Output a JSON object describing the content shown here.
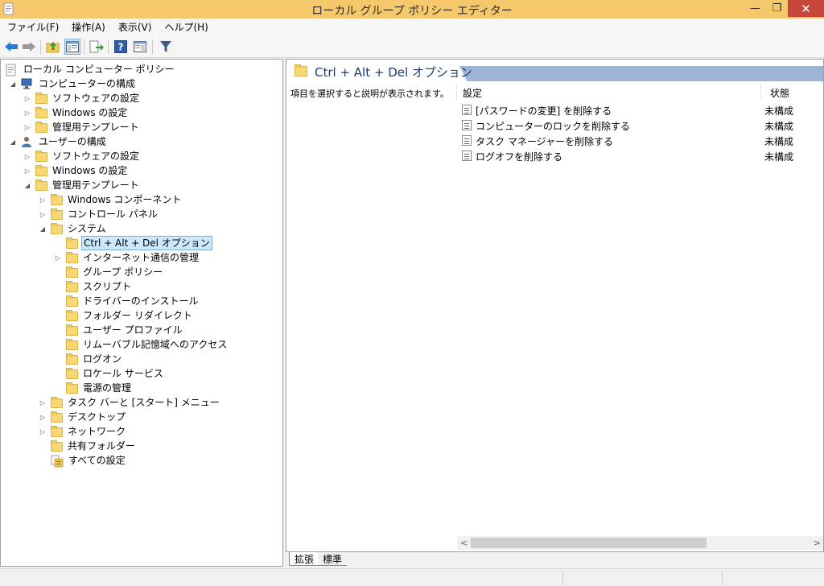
{
  "window": {
    "title": "ローカル グループ ポリシー エディター",
    "min_glyph": "—",
    "max_glyph": "❐",
    "close_glyph": "✕"
  },
  "menu": [
    {
      "label": "ファイル(F)"
    },
    {
      "label": "操作(A)"
    },
    {
      "label": "表示(V)"
    },
    {
      "label": "ヘルプ(H)"
    }
  ],
  "toolbar": {
    "icons": [
      "back-icon",
      "forward-icon",
      "up-folder-icon",
      "show-hide-tree-icon",
      "export-list-icon",
      "help-icon",
      "properties-icon",
      "filter-icon"
    ],
    "colors": {
      "arrow": "#2a7ad4",
      "filter": "#3c5a8a"
    }
  },
  "tree": {
    "items": [
      {
        "label": "ローカル コンピューター ポリシー",
        "level": 0,
        "expander": "",
        "icon": "policy-doc-icon"
      },
      {
        "label": "コンピューターの構成",
        "level": 1,
        "expander": "◢",
        "icon": "computer-icon"
      },
      {
        "label": "ソフトウェアの設定",
        "level": 2,
        "expander": "▷",
        "icon": "folder-icon"
      },
      {
        "label": "Windows の設定",
        "level": 2,
        "expander": "▷",
        "icon": "folder-icon"
      },
      {
        "label": "管理用テンプレート",
        "level": 2,
        "expander": "▷",
        "icon": "folder-icon"
      },
      {
        "label": "ユーザーの構成",
        "level": 1,
        "expander": "◢",
        "icon": "user-icon"
      },
      {
        "label": "ソフトウェアの設定",
        "level": 2,
        "expander": "▷",
        "icon": "folder-icon"
      },
      {
        "label": "Windows の設定",
        "level": 2,
        "expander": "▷",
        "icon": "folder-icon"
      },
      {
        "label": "管理用テンプレート",
        "level": 2,
        "expander": "◢",
        "icon": "folder-icon"
      },
      {
        "label": "Windows コンポーネント",
        "level": 3,
        "expander": "▷",
        "icon": "folder-icon"
      },
      {
        "label": "コントロール パネル",
        "level": 3,
        "expander": "▷",
        "icon": "folder-icon"
      },
      {
        "label": "システム",
        "level": 3,
        "expander": "◢",
        "icon": "folder-icon"
      },
      {
        "label": "Ctrl + Alt + Del オプション",
        "level": 4,
        "expander": "",
        "icon": "folder-icon",
        "selected": true
      },
      {
        "label": "インターネット通信の管理",
        "level": 4,
        "expander": "▷",
        "icon": "folder-icon"
      },
      {
        "label": "グループ ポリシー",
        "level": 4,
        "expander": "",
        "icon": "folder-icon"
      },
      {
        "label": "スクリプト",
        "level": 4,
        "expander": "",
        "icon": "folder-icon"
      },
      {
        "label": "ドライバーのインストール",
        "level": 4,
        "expander": "",
        "icon": "folder-icon"
      },
      {
        "label": "フォルダー リダイレクト",
        "level": 4,
        "expander": "",
        "icon": "folder-icon"
      },
      {
        "label": "ユーザー プロファイル",
        "level": 4,
        "expander": "",
        "icon": "folder-icon"
      },
      {
        "label": "リムーバブル記憶域へのアクセス",
        "level": 4,
        "expander": "",
        "icon": "folder-icon"
      },
      {
        "label": "ログオン",
        "level": 4,
        "expander": "",
        "icon": "folder-icon"
      },
      {
        "label": "ロケール サービス",
        "level": 4,
        "expander": "",
        "icon": "folder-icon"
      },
      {
        "label": "電源の管理",
        "level": 4,
        "expander": "",
        "icon": "folder-icon"
      },
      {
        "label": "タスク バーと [スタート] メニュー",
        "level": 3,
        "expander": "▷",
        "icon": "folder-icon"
      },
      {
        "label": "デスクトップ",
        "level": 3,
        "expander": "▷",
        "icon": "folder-icon"
      },
      {
        "label": "ネットワーク",
        "level": 3,
        "expander": "▷",
        "icon": "folder-icon"
      },
      {
        "label": "共有フォルダー",
        "level": 3,
        "expander": "",
        "icon": "folder-icon"
      },
      {
        "label": "すべての設定",
        "level": 3,
        "expander": "",
        "icon": "all-settings-icon"
      }
    ]
  },
  "details": {
    "title": "Ctrl + Alt + Del オプション",
    "description": "項目を選択すると説明が表示されます。",
    "columns": {
      "setting": "設定",
      "state": "状態"
    },
    "rows": [
      {
        "name": "[パスワードの変更] を削除する",
        "state": "未構成"
      },
      {
        "name": "コンピューターのロックを削除する",
        "state": "未構成"
      },
      {
        "name": "タスク マネージャーを削除する",
        "state": "未構成"
      },
      {
        "name": "ログオフを削除する",
        "state": "未構成"
      }
    ],
    "scroll_left": "<",
    "scroll_right": ">"
  },
  "tabs": {
    "extended": "拡張",
    "standard": "標準"
  },
  "colors": {
    "titlebar": "#f5c86b",
    "header_band": "#9eb4d4",
    "selection": "#cce8ff",
    "close": "#c7463b"
  }
}
